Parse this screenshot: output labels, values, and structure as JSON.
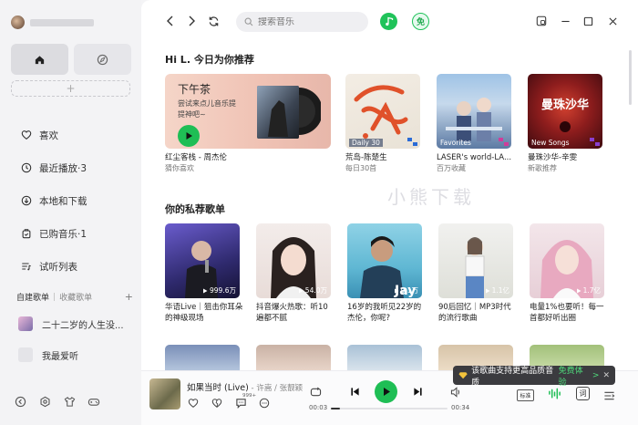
{
  "app": {
    "accent": "#1fbe55"
  },
  "sidebar": {
    "nav_tabs": [
      {
        "icon": "home-icon"
      },
      {
        "icon": "compass-icon"
      }
    ],
    "add_label": "+",
    "menu": [
      {
        "icon": "heart-icon",
        "label": "喜欢"
      },
      {
        "icon": "clock-icon",
        "label": "最近播放·3"
      },
      {
        "icon": "download-icon",
        "label": "本地和下载"
      },
      {
        "icon": "purchased-icon",
        "label": "已购音乐·1"
      },
      {
        "icon": "playlist-icon",
        "label": "试听列表"
      }
    ],
    "playlist_tabs": {
      "created": "自建歌单",
      "sep": "|",
      "collected": "收藏歌单",
      "add": "+"
    },
    "playlists": [
      {
        "label": "二十二岁的人生没..."
      },
      {
        "label": "我最爱听"
      }
    ]
  },
  "topbar": {
    "search_placeholder": "搜索音乐",
    "free_label": "免"
  },
  "recommend": {
    "title": "Hi L. 今日为你推荐",
    "hero": {
      "title": "下午茶",
      "subtitle": "尝试来点儿音乐提提神吧~",
      "caption": "红尘客栈 - 周杰伦",
      "sub": "猜你喜欢"
    },
    "cards": [
      {
        "tag": "Daily 30",
        "title": "荒岛-陈楚生",
        "sub": "每日30首"
      },
      {
        "tag": "Favorites",
        "title": "LASER's world-LA...",
        "sub": "百万收藏"
      },
      {
        "tag": "New Songs",
        "title": "曼珠沙华-辛雯",
        "sub": "新歌推荐"
      }
    ]
  },
  "private": {
    "title": "你的私荐歌单",
    "cards": [
      {
        "count": "999.6万",
        "desc": "华语Live｜狙击你耳朵的神级现场"
      },
      {
        "count": "54.0万",
        "desc": "抖音爆火热歌：听10遍都不腻"
      },
      {
        "count": "9.1万",
        "desc": "16岁的我听见22岁的杰伦，你呢?"
      },
      {
        "count": "1.1亿",
        "desc": "90后回忆｜MP3时代的流行歌曲"
      },
      {
        "count": "1.7亿",
        "desc": "电量1%也要听！每一首都好听出圈"
      }
    ]
  },
  "watermark": "小熊下载",
  "player": {
    "song": "如果当时 (Live)",
    "artist": " - 许嵩 / 张靓颖",
    "comment_badge": "999+",
    "time_current": "00:03",
    "time_total": "00:34",
    "progress": 0.08,
    "quality_label": "标准",
    "lyric_label": "词",
    "tooltip": {
      "text": "该歌曲支持更高品质音质",
      "action": "免费体验",
      "arrow": ">",
      "close": "✕"
    }
  }
}
